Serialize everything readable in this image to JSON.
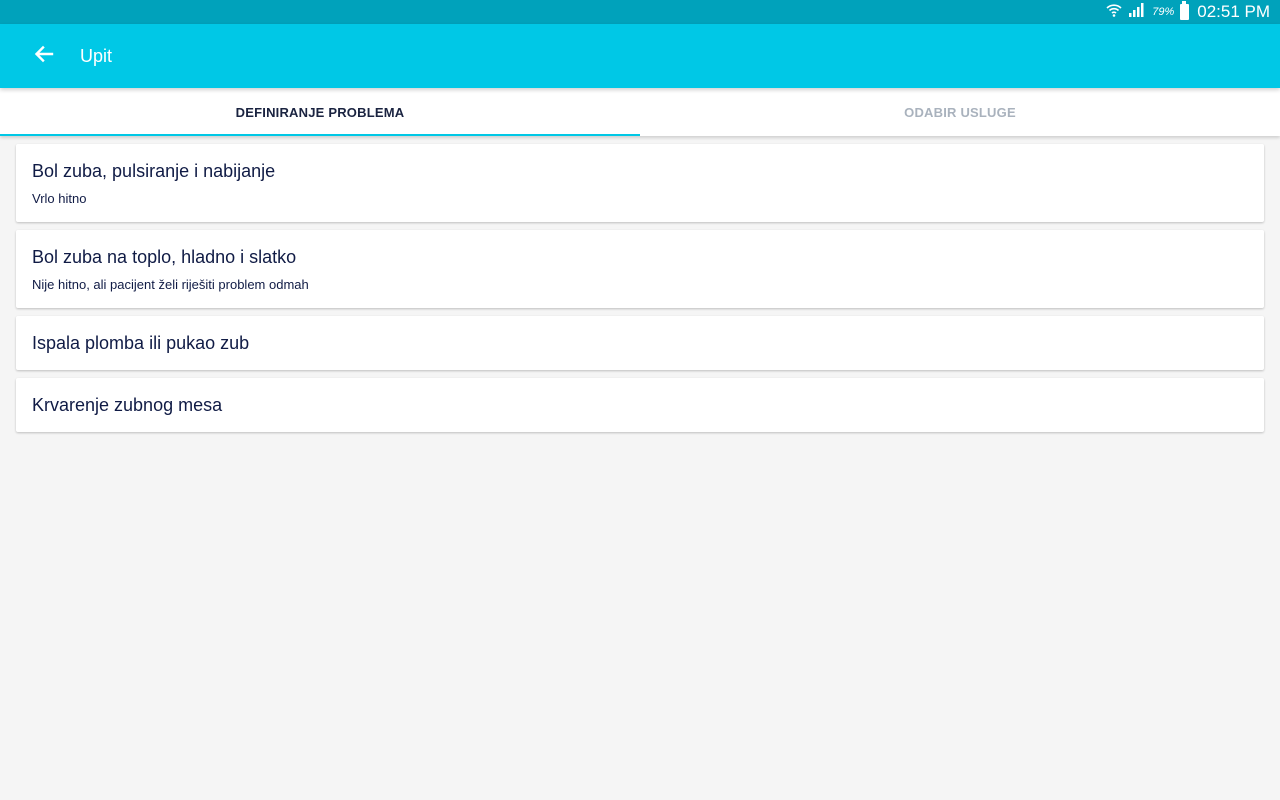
{
  "status_bar": {
    "battery_percent": "79%",
    "time": "02:51 PM",
    "icons": [
      "wifi-icon",
      "signal-icon",
      "battery-icon"
    ]
  },
  "app_bar": {
    "title": "Upit",
    "back_icon": "arrow-back-icon"
  },
  "tabs": [
    {
      "label": "DEFINIRANJE PROBLEMA",
      "active": true
    },
    {
      "label": "ODABIR USLUGE",
      "active": false
    }
  ],
  "problems": [
    {
      "title": "Bol zuba, pulsiranje i nabijanje",
      "subtitle": "Vrlo hitno"
    },
    {
      "title": "Bol zuba na toplo, hladno i slatko",
      "subtitle": "Nije hitno, ali pacijent želi riješiti problem odmah"
    },
    {
      "title": "Ispala plomba ili pukao zub"
    },
    {
      "title": "Krvarenje zubnog mesa"
    }
  ],
  "colors": {
    "status_bar": "#00a2bb",
    "app_bar": "#00c8e6",
    "tab_indicator": "#00c8e6",
    "text_dark": "#101b45",
    "tab_inactive": "#a9b2bd",
    "background": "#f5f5f5"
  }
}
